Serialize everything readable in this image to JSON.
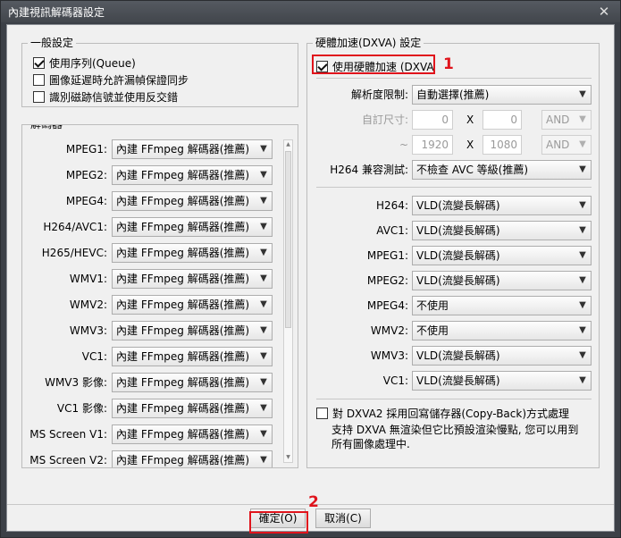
{
  "window": {
    "title": "內建視訊解碼器設定",
    "close_glyph": "✕"
  },
  "general": {
    "legend": "一般設定",
    "options": [
      {
        "label": "使用序列(Queue)",
        "checked": true
      },
      {
        "label": "圖像延遲時允許漏幀保證同步",
        "checked": false
      },
      {
        "label": "識別磁跡信號並使用反交錯",
        "checked": false
      }
    ]
  },
  "decoders": {
    "legend": "解碼器",
    "items": [
      {
        "label": "MPEG1:",
        "value": "內建 FFmpeg 解碼器(推薦)"
      },
      {
        "label": "MPEG2:",
        "value": "內建 FFmpeg 解碼器(推薦)"
      },
      {
        "label": "MPEG4:",
        "value": "內建 FFmpeg 解碼器(推薦)"
      },
      {
        "label": "H264/AVC1:",
        "value": "內建 FFmpeg 解碼器(推薦)"
      },
      {
        "label": "H265/HEVC:",
        "value": "內建 FFmpeg 解碼器(推薦)"
      },
      {
        "label": "WMV1:",
        "value": "內建 FFmpeg 解碼器(推薦)"
      },
      {
        "label": "WMV2:",
        "value": "內建 FFmpeg 解碼器(推薦)"
      },
      {
        "label": "WMV3:",
        "value": "內建 FFmpeg 解碼器(推薦)"
      },
      {
        "label": "VC1:",
        "value": "內建 FFmpeg 解碼器(推薦)"
      },
      {
        "label": "WMV3 影像:",
        "value": "內建 FFmpeg 解碼器(推薦)"
      },
      {
        "label": "VC1 影像:",
        "value": "內建 FFmpeg 解碼器(推薦)"
      },
      {
        "label": "MS Screen V1:",
        "value": "內建 FFmpeg 解碼器(推薦)"
      },
      {
        "label": "MS Screen V2:",
        "value": "內建 FFmpeg 解碼器(推薦)"
      }
    ]
  },
  "dxva": {
    "legend": "硬體加速(DXVA) 設定",
    "enable_label": "使用硬體加速 (DXVA",
    "enable_checked": true,
    "resolution_label": "解析度限制:",
    "resolution_value": "自動選擇(推薦)",
    "custom_label": "自訂尺寸:",
    "min_w": "0",
    "min_h": "0",
    "max_prefix": "~",
    "max_w": "1920",
    "max_h": "1080",
    "times": "X",
    "and_value": "AND",
    "h264_test_label": "H264 兼容測試:",
    "h264_test_value": "不檢查 AVC 等級(推薦)",
    "codecs": [
      {
        "label": "H264:",
        "value": "VLD(流變長解碼)"
      },
      {
        "label": "AVC1:",
        "value": "VLD(流變長解碼)"
      },
      {
        "label": "MPEG1:",
        "value": "VLD(流變長解碼)"
      },
      {
        "label": "MPEG2:",
        "value": "VLD(流變長解碼)"
      },
      {
        "label": "MPEG4:",
        "value": "不使用"
      },
      {
        "label": "WMV2:",
        "value": "不使用"
      },
      {
        "label": "WMV3:",
        "value": "VLD(流變長解碼)"
      },
      {
        "label": "VC1:",
        "value": "VLD(流變長解碼)"
      }
    ],
    "copyback_label": "對 DXVA2 採用回寫儲存器(Copy-Back)方式處理",
    "copyback_checked": false,
    "note_line1": "支持 DXVA 無渲染但它比預設渲染慢點, 您可以用到",
    "note_line2": "所有圖像處理中."
  },
  "buttons": {
    "ok": "確定(O)",
    "cancel": "取消(C)"
  },
  "annotations": {
    "marker1": "1",
    "marker2": "2"
  },
  "colors": {
    "highlight": "#e0141c"
  }
}
